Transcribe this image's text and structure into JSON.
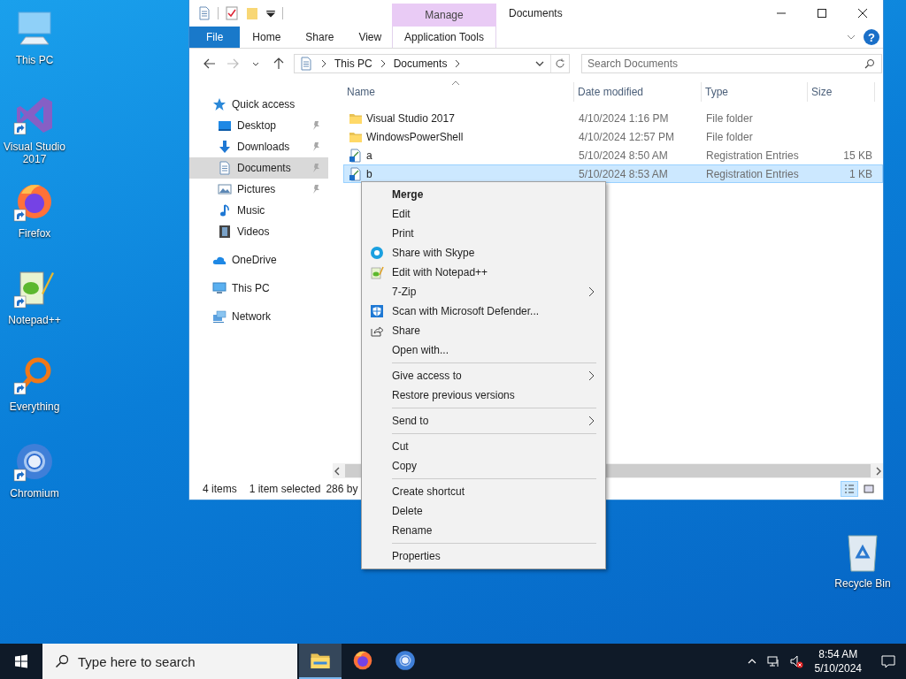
{
  "desktop": {
    "icons": [
      {
        "label": "This PC",
        "kind": "pc",
        "shortcut": false
      },
      {
        "label": "Visual Studio 2017",
        "kind": "vs",
        "shortcut": true
      },
      {
        "label": "Firefox",
        "kind": "firefox",
        "shortcut": true
      },
      {
        "label": "Notepad++",
        "kind": "notepadpp",
        "shortcut": true
      },
      {
        "label": "Everything",
        "kind": "everything",
        "shortcut": true
      },
      {
        "label": "Chromium",
        "kind": "chromium",
        "shortcut": true
      }
    ],
    "recycle_bin": {
      "label": "Recycle Bin"
    }
  },
  "explorer": {
    "title": "Documents",
    "context_group": "Manage",
    "tabs": [
      {
        "label": "File",
        "kind": "file"
      },
      {
        "label": "Home",
        "kind": "tab"
      },
      {
        "label": "Share",
        "kind": "tab"
      },
      {
        "label": "View",
        "kind": "tab"
      },
      {
        "label": "Application Tools",
        "kind": "context"
      }
    ],
    "help_button": "?",
    "address": [
      "This PC",
      "Documents"
    ],
    "search_placeholder": "Search Documents",
    "nav": [
      {
        "label": "Quick access",
        "kind": "star",
        "selected": false,
        "children": [
          {
            "label": "Desktop",
            "kind": "desktop",
            "pinned": true,
            "selected": false
          },
          {
            "label": "Downloads",
            "kind": "download",
            "pinned": true,
            "selected": false
          },
          {
            "label": "Documents",
            "kind": "document",
            "pinned": true,
            "selected": true
          },
          {
            "label": "Pictures",
            "kind": "pictures",
            "pinned": true,
            "selected": false
          },
          {
            "label": "Music",
            "kind": "music",
            "pinned": false,
            "selected": false
          },
          {
            "label": "Videos",
            "kind": "videos",
            "pinned": false,
            "selected": false
          }
        ]
      },
      {
        "label": "OneDrive",
        "kind": "cloud",
        "selected": false
      },
      {
        "label": "This PC",
        "kind": "pc",
        "selected": false
      },
      {
        "label": "Network",
        "kind": "network",
        "selected": false
      }
    ],
    "columns": [
      "Name",
      "Date modified",
      "Type",
      "Size"
    ],
    "rows": [
      {
        "name": "Visual Studio 2017",
        "date": "4/10/2024 1:16 PM",
        "type": "File folder",
        "kind": "folder",
        "selected": false
      },
      {
        "name": "WindowsPowerShell",
        "date": "4/10/2024 12:57 PM",
        "type": "File folder",
        "kind": "folder",
        "selected": false
      },
      {
        "name": "a",
        "date": "5/10/2024 8:50 AM",
        "type": "Registration Entries",
        "size": "15 KB",
        "kind": "reg",
        "selected": false
      },
      {
        "name": "b",
        "date": "5/10/2024 8:53 AM",
        "type": "Registration Entries",
        "size": "1 KB",
        "kind": "reg",
        "selected": true
      }
    ],
    "status": {
      "count": "4 items",
      "selection": "1 item selected",
      "size": "286 by"
    },
    "view_buttons": [
      {
        "kind": "details",
        "selected": true
      },
      {
        "kind": "tiles",
        "selected": false
      }
    ]
  },
  "context_menu": [
    {
      "kind": "plain",
      "label": "Merge",
      "default": true,
      "submenu": false
    },
    {
      "kind": "plain",
      "label": "Edit",
      "default": false,
      "submenu": false
    },
    {
      "kind": "plain",
      "label": "Print",
      "default": false,
      "submenu": false
    },
    {
      "kind": "skype",
      "label": "Share with Skype",
      "default": false,
      "submenu": false
    },
    {
      "kind": "notepad",
      "label": "Edit with Notepad++",
      "default": false,
      "submenu": false
    },
    {
      "kind": "plain",
      "label": "7-Zip",
      "default": false,
      "submenu": true
    },
    {
      "kind": "defender",
      "label": "Scan with Microsoft Defender...",
      "default": false,
      "submenu": false
    },
    {
      "kind": "share",
      "label": "Share",
      "default": false,
      "submenu": false
    },
    {
      "kind": "plain",
      "label": "Open with...",
      "default": false,
      "submenu": false
    },
    {
      "kind": "separator"
    },
    {
      "kind": "plain",
      "label": "Give access to",
      "default": false,
      "submenu": true
    },
    {
      "kind": "plain",
      "label": "Restore previous versions",
      "default": false,
      "submenu": false
    },
    {
      "kind": "separator"
    },
    {
      "kind": "plain",
      "label": "Send to",
      "default": false,
      "submenu": true
    },
    {
      "kind": "separator"
    },
    {
      "kind": "plain",
      "label": "Cut",
      "default": false,
      "submenu": false
    },
    {
      "kind": "plain",
      "label": "Copy",
      "default": false,
      "submenu": false
    },
    {
      "kind": "separator"
    },
    {
      "kind": "plain",
      "label": "Create shortcut",
      "default": false,
      "submenu": false
    },
    {
      "kind": "plain",
      "label": "Delete",
      "default": false,
      "submenu": false
    },
    {
      "kind": "plain",
      "label": "Rename",
      "default": false,
      "submenu": false
    },
    {
      "kind": "separator"
    },
    {
      "kind": "plain",
      "label": "Properties",
      "default": false,
      "submenu": false
    }
  ],
  "taskbar": {
    "search_placeholder": "Type here to search",
    "apps": [
      {
        "kind": "explorer",
        "active": true
      },
      {
        "kind": "firefox",
        "active": false
      },
      {
        "kind": "chromium",
        "active": false
      }
    ],
    "time": "8:54 AM",
    "date": "5/10/2024"
  }
}
